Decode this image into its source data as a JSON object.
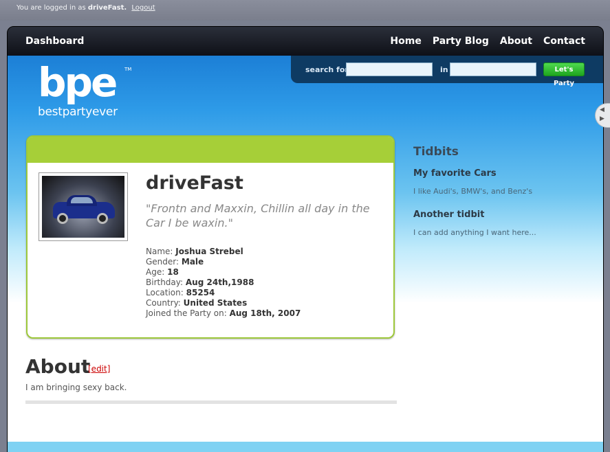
{
  "topbar": {
    "prefix": "You are logged in as",
    "username": "driveFast.",
    "logout": "Logout"
  },
  "nav": {
    "dashboard": "Dashboard",
    "links": [
      "Home",
      "Party Blog",
      "About",
      "Contact"
    ]
  },
  "search": {
    "label_for": "search for",
    "label_in": "in",
    "for_value": "",
    "in_value": "",
    "button": "Let's Party"
  },
  "logo": {
    "mark": "bpe",
    "tm": "TM",
    "word": "bestpartyever"
  },
  "profile": {
    "name": "driveFast",
    "quote": "\"Frontn and Maxxin, Chillin all day in the Car I be waxin.\"",
    "details": [
      {
        "label": "Name:",
        "value": "Joshua Strebel"
      },
      {
        "label": "Gender:",
        "value": "Male"
      },
      {
        "label": "Age:",
        "value": "18"
      },
      {
        "label": "Birthday:",
        "value": "Aug 24th,1988"
      },
      {
        "label": "Location:",
        "value": "85254"
      },
      {
        "label": "Country:",
        "value": "United States"
      },
      {
        "label": "Joined the Party on:",
        "value": "Aug 18th, 2007"
      }
    ]
  },
  "about": {
    "heading": "About",
    "edit": "[edit]",
    "text": "I am bringing sexy back."
  },
  "tidbits": {
    "heading": "Tidbits",
    "items": [
      {
        "title": "My favorite Cars",
        "text": "I like Audi's, BMW's, and Benz's"
      },
      {
        "title": "Another tidbit",
        "text": "I can add anything I want here..."
      }
    ]
  },
  "colors": {
    "accent_green": "#a6cf38",
    "button_green": "#1ea51e",
    "edit_red": "#cc0000"
  }
}
